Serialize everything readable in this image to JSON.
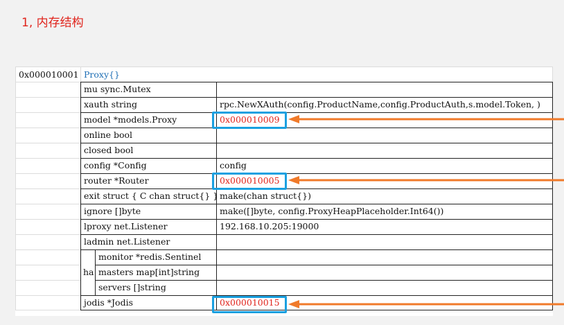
{
  "heading": "1, 内存结构",
  "struct": {
    "address": "0x000010001",
    "title": "Proxy{}",
    "rows": [
      {
        "field": "mu sync.Mutex",
        "value": ""
      },
      {
        "field": "xauth string",
        "value": "rpc.NewXAuth(config.ProductName,config.ProductAuth,s.model.Token, )"
      },
      {
        "field": "model *models.Proxy",
        "value": "0x000010009",
        "pointer": true
      },
      {
        "field": "online bool",
        "value": ""
      },
      {
        "field": "closed bool",
        "value": ""
      },
      {
        "field": "config *Config",
        "value": "config"
      },
      {
        "field": "router *Router",
        "value": "0x000010005",
        "pointer": true
      },
      {
        "field": "exit struct { C chan struct{} }",
        "value": "make(chan struct{})"
      },
      {
        "field": "ignore []byte",
        "value": "make([]byte, config.ProxyHeapPlaceholder.Int64())"
      },
      {
        "field": "lproxy net.Listener",
        "value": "192.168.10.205:19000"
      },
      {
        "field": "ladmin net.Listener",
        "value": ""
      }
    ],
    "group": {
      "label": "ha",
      "rows": [
        {
          "field": "monitor *redis.Sentinel",
          "value": ""
        },
        {
          "field": "masters map[int]string",
          "value": ""
        },
        {
          "field": "servers []string",
          "value": ""
        }
      ]
    },
    "last_row": {
      "field": "jodis *Jodis",
      "value": "0x000010015",
      "pointer": true
    }
  },
  "colors": {
    "heading": "#e0241c",
    "pointer_text": "#e0241c",
    "title": "#1f6fb5",
    "highlight": "#1aa0e0",
    "arrow": "#f07a2a"
  }
}
